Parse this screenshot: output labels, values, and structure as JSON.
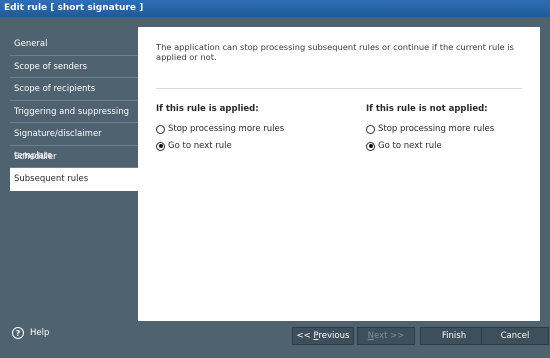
{
  "window": {
    "title": "Edit rule [ short signature ]"
  },
  "sidebar": {
    "items": [
      {
        "label": "General"
      },
      {
        "label": "Scope of senders"
      },
      {
        "label": "Scope of recipients"
      },
      {
        "label": "Triggering and suppressing"
      },
      {
        "label": "Signature/disclaimer template"
      },
      {
        "label": "Scheduler"
      },
      {
        "label": "Subsequent rules",
        "active": true
      }
    ]
  },
  "content": {
    "description": "The application can stop processing subsequent rules or continue if the current rule is applied or not.",
    "applied": {
      "title": "If this rule is applied:",
      "options": [
        {
          "label": "Stop processing more rules",
          "checked": false
        },
        {
          "label": "Go to next rule",
          "checked": true
        }
      ]
    },
    "not_applied": {
      "title": "If this rule is not applied:",
      "options": [
        {
          "label": "Stop processing more rules",
          "checked": false
        },
        {
          "label": "Go to next rule",
          "checked": true
        }
      ]
    }
  },
  "footer": {
    "help_label": "Help",
    "prev_prefix": "<< ",
    "prev_underlined": "P",
    "prev_rest": "revious",
    "next_underlined": "N",
    "next_rest": "ext >>",
    "finish_label": "Finish",
    "cancel_label": "Cancel"
  }
}
